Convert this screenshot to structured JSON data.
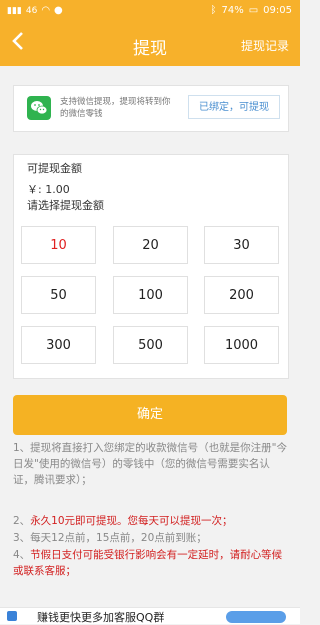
{
  "status_bar": {
    "battery": "74%",
    "time": "09:05",
    "signal": "46",
    "colors": {
      "bar": "#f7b12b"
    }
  },
  "nav": {
    "title": "提现",
    "right_label": "提现记录",
    "back_icon": "chevron-left-icon"
  },
  "wechat": {
    "description": "支持微信提现，提现将转到你的微信零钱",
    "status_button": "已绑定，可提现",
    "icon": "wechat-icon"
  },
  "amount": {
    "label": "可提现金额",
    "value": "￥: 1.00",
    "choose_label": "请选择提现金额",
    "options": [
      "10",
      "20",
      "30",
      "50",
      "100",
      "200",
      "300",
      "500",
      "1000"
    ],
    "selected": "10"
  },
  "confirm_label": "确定",
  "notes": {
    "n1": "1、提现将直接打入您绑定的收款微信号（也就是你注册\"今日发\"使用的微信号）的零钱中（您的微信号需要实名认证，腾讯要求）；",
    "n2_prefix": "2、",
    "n2_red": "永久10元即可提现。您每天可以提现一次；",
    "n3": "3、每天12点前，15点前，20点前到账；",
    "n4_prefix": "4、",
    "n4_red": "节假日支付可能受银行影响会有一定延时，请耐心等候或联系客服；"
  },
  "bottom": {
    "text": "赚钱更快更多加客服QQ群"
  },
  "colors": {
    "accent": "#f7b12b",
    "link": "#4a8fd0",
    "warn": "#d21f1f",
    "wechat_green": "#2fb34f"
  }
}
